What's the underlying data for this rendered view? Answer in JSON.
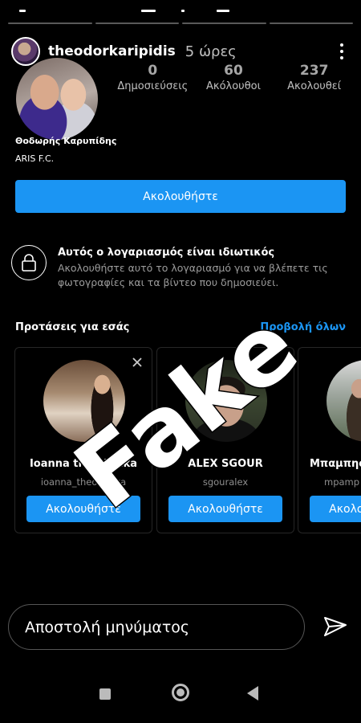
{
  "story": {
    "segments": 4
  },
  "header": {
    "username": "theodorkaripidis",
    "time_ago": "5 ώρες"
  },
  "stats": [
    {
      "value": "0",
      "label": "Δημοσιεύσεις"
    },
    {
      "value": "60",
      "label": "Ακόλουθοι"
    },
    {
      "value": "237",
      "label": "Ακολουθεί"
    }
  ],
  "profile": {
    "full_name": "Θοδωρής Καρυπίδης",
    "bio": "ARIS F.C.",
    "follow_label": "Ακολουθήστε"
  },
  "private_notice": {
    "title": "Αυτός ο λογαριασμός είναι ιδιωτικός",
    "description": "Ακολουθήστε αυτό το λογαριασμό για να βλέπετε τις φωτογραφίες και τα βίντεο που δημοσιεύει."
  },
  "suggestions": {
    "title": "Προτάσεις για εσάς",
    "see_all": "Προβολή όλων",
    "cards": [
      {
        "name": "Ioanna theodorika",
        "handle": "ioanna_theodorika",
        "button": "Ακολουθήστε",
        "has_close": true
      },
      {
        "name": "ALEX SGOUR",
        "handle": "sgouralex",
        "button": "Ακολουθήστε",
        "has_close": false
      },
      {
        "name": "Μπαμπης",
        "handle": "mpamp",
        "button": "Ακολουθήστε",
        "has_close": false
      }
    ]
  },
  "overlay": {
    "stamp_text": "Fake"
  },
  "message": {
    "placeholder": "Αποστολή μηνύματος"
  },
  "colors": {
    "accent": "#1b95f3",
    "background": "#000000"
  }
}
